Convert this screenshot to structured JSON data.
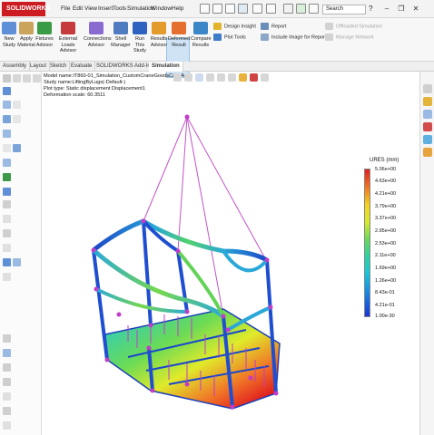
{
  "app": {
    "logo": "SOLIDWORKS"
  },
  "menu": [
    "File",
    "Edit",
    "View",
    "Insert",
    "Tools",
    "Simulation",
    "Window",
    "Help"
  ],
  "search": {
    "placeholder": "Search"
  },
  "ribbon": {
    "new_study": "New Study",
    "apply_material": "Apply Material",
    "fixtures_advisor": "Fixtures Advisor",
    "external_loads_advisor": "External Loads Advisor",
    "connections_advisor": "Connections Advisor",
    "shell_manager": "Shell Manager",
    "run_this_study": "Run This Study",
    "results_advisor": "Results Advisor",
    "deformed_result": "Deformed Result",
    "compare_results": "Compare Results",
    "design_insight": "Design Insight",
    "plot_tools": "Plot Tools",
    "report": "Report",
    "include_image": "Include Image for Report",
    "offloaded_simulation": "Offloaded Simulation",
    "manage_network": "Manage Network"
  },
  "tabs": [
    "Assembly",
    "Layout",
    "Sketch",
    "Evaluate",
    "SOLIDWORKS Add-Ins",
    "Simulation"
  ],
  "model_info": {
    "model_name": "Model name:IT860-01_Simulation_CustomCraneGoodsCageAssy",
    "study_name": "Study name:LiftingByLugs(-Default-)",
    "plot_type": "Plot type: Static displacement Displacement1",
    "deformation_scale": "Deformation scale: 60.3511"
  },
  "legend": {
    "title": "URES (mm)",
    "labels": [
      "5.06e+00",
      "4.63e+00",
      "4.21e+00",
      "3.79e+00",
      "3.37e+00",
      "2.95e+00",
      "2.53e+00",
      "2.11e+00",
      "1.69e+00",
      "1.26e+00",
      "8.43e-01",
      "4.21e-01",
      "1.00e-30"
    ]
  },
  "colors": {
    "brand": "#cc1c22",
    "frame_blue": "#1c46c8",
    "lift_cable": "#c254c7",
    "node_magenta": "#c13cc8"
  }
}
